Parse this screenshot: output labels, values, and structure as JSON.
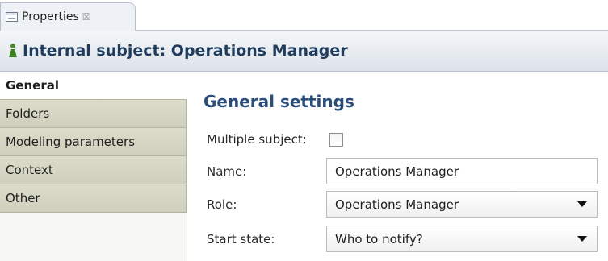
{
  "tab": {
    "label": "Properties",
    "close": "☒"
  },
  "header": {
    "icon": "person-icon",
    "title": "Internal subject: Operations Manager"
  },
  "sidebar": {
    "items": [
      {
        "label": "General",
        "active": true
      },
      {
        "label": "Folders",
        "active": false
      },
      {
        "label": "Modeling parameters",
        "active": false
      },
      {
        "label": "Context",
        "active": false
      },
      {
        "label": "Other",
        "active": false
      }
    ]
  },
  "main": {
    "section_title": "General settings",
    "multiple_subject": {
      "label": "Multiple subject:",
      "checked": false
    },
    "name": {
      "label": "Name:",
      "value": "Operations Manager"
    },
    "role": {
      "label": "Role:",
      "value": "Operations Manager"
    },
    "start_state": {
      "label": "Start state:",
      "value": "Who to notify?"
    }
  },
  "colors": {
    "header_title": "#1f3c5c",
    "section_title": "#2a4d7a",
    "sidebar_tab": "#d6d6c4"
  }
}
